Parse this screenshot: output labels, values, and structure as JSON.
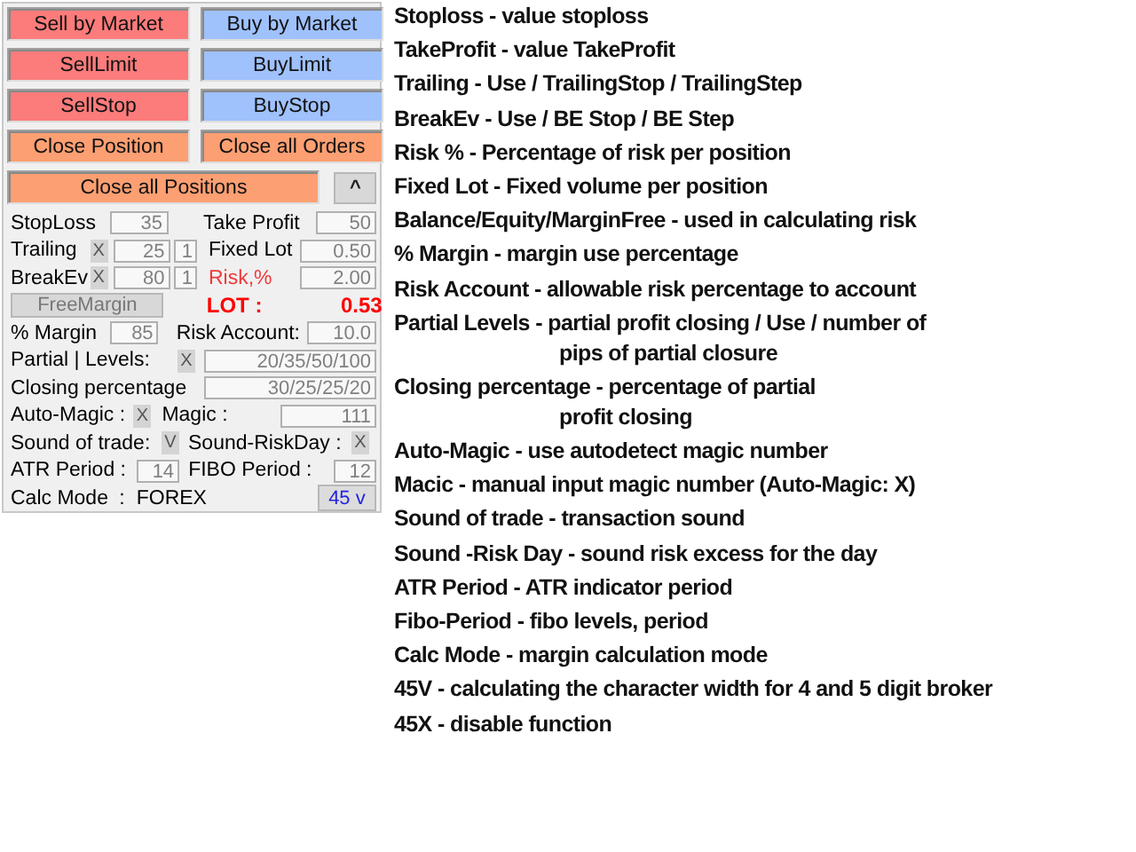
{
  "order_buttons": [
    {
      "label": "Sell by Market",
      "kind": "sell"
    },
    {
      "label": "Buy by Market",
      "kind": "buy"
    },
    {
      "label": "SellLimit",
      "kind": "sell"
    },
    {
      "label": "BuyLimit",
      "kind": "buy"
    },
    {
      "label": "SellStop",
      "kind": "sell"
    },
    {
      "label": "BuyStop",
      "kind": "buy"
    },
    {
      "label": "Close Position",
      "kind": "close"
    },
    {
      "label": "Close all Orders",
      "kind": "close"
    }
  ],
  "close_all": {
    "label": "Close all Positions"
  },
  "collapse": {
    "label": "^"
  },
  "stoploss": {
    "label": "StopLoss",
    "value": "35"
  },
  "take_profit": {
    "label": "Take Profit",
    "value": "50"
  },
  "trailing": {
    "label": "Trailing",
    "toggle": "X",
    "stop": "25",
    "step": "1"
  },
  "fixed_lot": {
    "label": "Fixed Lot",
    "value": "0.50"
  },
  "breakeven": {
    "label": "BreakEv",
    "toggle": "X",
    "stop": "80",
    "step": "1"
  },
  "risk": {
    "label": "Risk,%",
    "value": "2.00"
  },
  "risk_base": {
    "label": "FreeMargin"
  },
  "lot": {
    "label": "LOT :",
    "value": "0.53"
  },
  "margin": {
    "label": "% Margin",
    "value": "85"
  },
  "risk_account": {
    "label": "Risk Account:",
    "value": "10.0"
  },
  "partial": {
    "label": "Partial | Levels:",
    "toggle": "X",
    "value": "20/35/50/100"
  },
  "closing": {
    "label": "Closing percentage",
    "value": "30/25/25/20"
  },
  "auto_magic": {
    "label": "Auto-Magic :",
    "toggle": "X"
  },
  "magic": {
    "label": "Magic :",
    "value": "111"
  },
  "sound_trade": {
    "label": "Sound of trade:",
    "toggle": "V"
  },
  "sound_risk": {
    "label": "Sound-RiskDay :",
    "toggle": "X"
  },
  "atr": {
    "label": "ATR Period :",
    "value": "14"
  },
  "fibo": {
    "label": "FIBO Period :",
    "value": "12"
  },
  "calc_mode": {
    "label": "Calc Mode",
    "separator": ":",
    "value": "FOREX"
  },
  "digits_button": {
    "label": "45 v"
  },
  "notes": [
    {
      "text": "Stoploss - value stoploss"
    },
    {
      "text": "TakeProfit - value TakeProfit"
    },
    {
      "text": "Trailing - Use / TrailingStop / TrailingStep"
    },
    {
      "text": "BreakEv - Use / BE Stop / BE Step"
    },
    {
      "text": "Risk % - Percentage of risk per position"
    },
    {
      "text": "Fixed Lot - Fixed volume per position"
    },
    {
      "text": "Balance/Equity/MarginFree - used in calculating risk"
    },
    {
      "text": "% Margin - margin use percentage"
    },
    {
      "text": "Risk Account - allowable risk percentage to account"
    },
    {
      "text": "Partial Levels - partial profit closing / Use / number of",
      "continuation": "pips of partial closure"
    },
    {
      "text": "Closing percentage - percentage of partial",
      "continuation": "profit closing"
    },
    {
      "text": "Auto-Magic - use autodetect magic number"
    },
    {
      "text": "Macic - manual input magic number (Auto-Magic: X)"
    },
    {
      "text": "Sound of trade - transaction sound"
    },
    {
      "text": "Sound -Risk Day - sound risk excess for the day"
    },
    {
      "text": "ATR Period - ATR indicator period"
    },
    {
      "text": "Fibo-Period - fibo levels, period"
    },
    {
      "text": "Calc Mode - margin calculation mode"
    },
    {
      "text": "45V - calculating the character width for 4 and 5 digit broker"
    },
    {
      "text": "45X - disable function"
    }
  ]
}
